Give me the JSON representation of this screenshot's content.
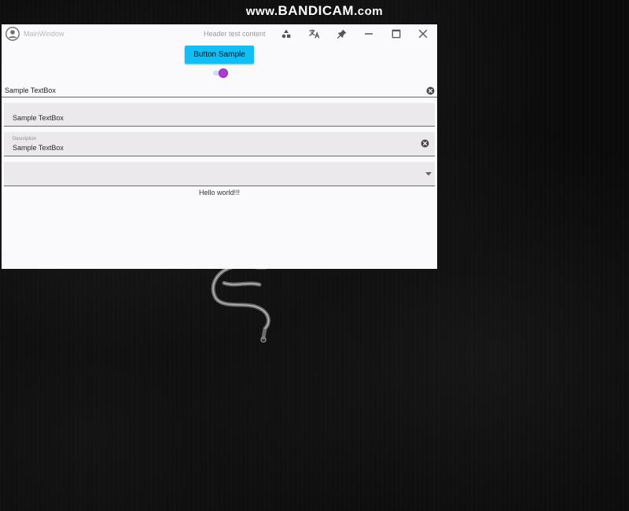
{
  "watermark": {
    "prefix": "www.",
    "brand": "BANDICAM",
    "suffix": ".com"
  },
  "window": {
    "title": "MainWindow",
    "header_content": "Header test content",
    "titlebar_icons": [
      "avatar-icon",
      "shapes-icon",
      "translate-icon",
      "pin-icon",
      "minimize-icon",
      "maximize-icon",
      "close-icon"
    ]
  },
  "content": {
    "button_label": "Button Sample",
    "toggle": {
      "checked": true
    },
    "textbox_plain": {
      "value": "Sample TextBox"
    },
    "textbox_filled": {
      "value": "Sample TextBox"
    },
    "textbox_described": {
      "hint": "Description",
      "value": "Sample TextBox"
    },
    "combobox": {
      "selected": ""
    },
    "hello_text": "Hello world!!!"
  },
  "colors": {
    "accent_button": "#12bff5",
    "toggle_thumb": "#b03ad6",
    "window_bg": "#faf9fc",
    "field_bg": "#ebe9ec"
  }
}
